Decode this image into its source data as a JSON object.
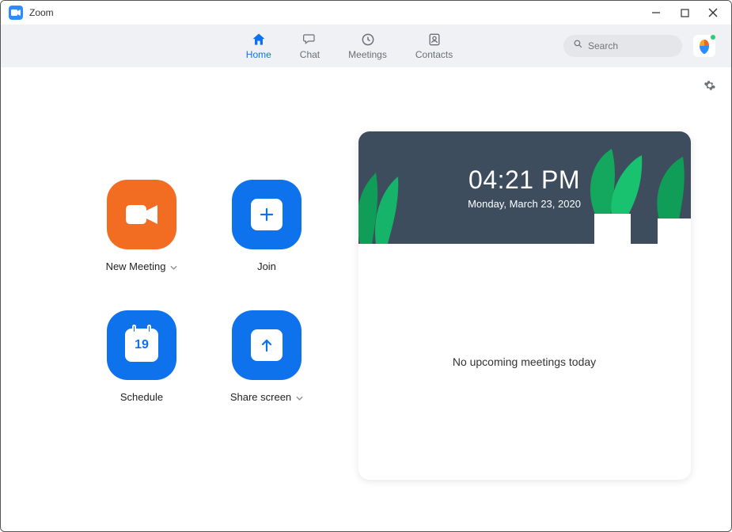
{
  "app": {
    "title": "Zoom"
  },
  "nav": {
    "items": [
      {
        "id": "home",
        "label": "Home",
        "active": true
      },
      {
        "id": "chat",
        "label": "Chat",
        "active": false
      },
      {
        "id": "meetings",
        "label": "Meetings",
        "active": false
      },
      {
        "id": "contacts",
        "label": "Contacts",
        "active": false
      }
    ],
    "search_placeholder": "Search"
  },
  "actions": {
    "new_meeting": {
      "label": "New Meeting"
    },
    "join": {
      "label": "Join"
    },
    "schedule": {
      "label": "Schedule",
      "calendar_day": "19"
    },
    "share_screen": {
      "label": "Share screen"
    }
  },
  "clock": {
    "time": "04:21 PM",
    "date": "Monday, March 23, 2020"
  },
  "meetings_panel": {
    "empty_text": "No upcoming meetings today"
  },
  "colors": {
    "accent_blue": "#0e72ed",
    "accent_orange": "#f26d21",
    "nav_bg": "#f0f1f4"
  }
}
